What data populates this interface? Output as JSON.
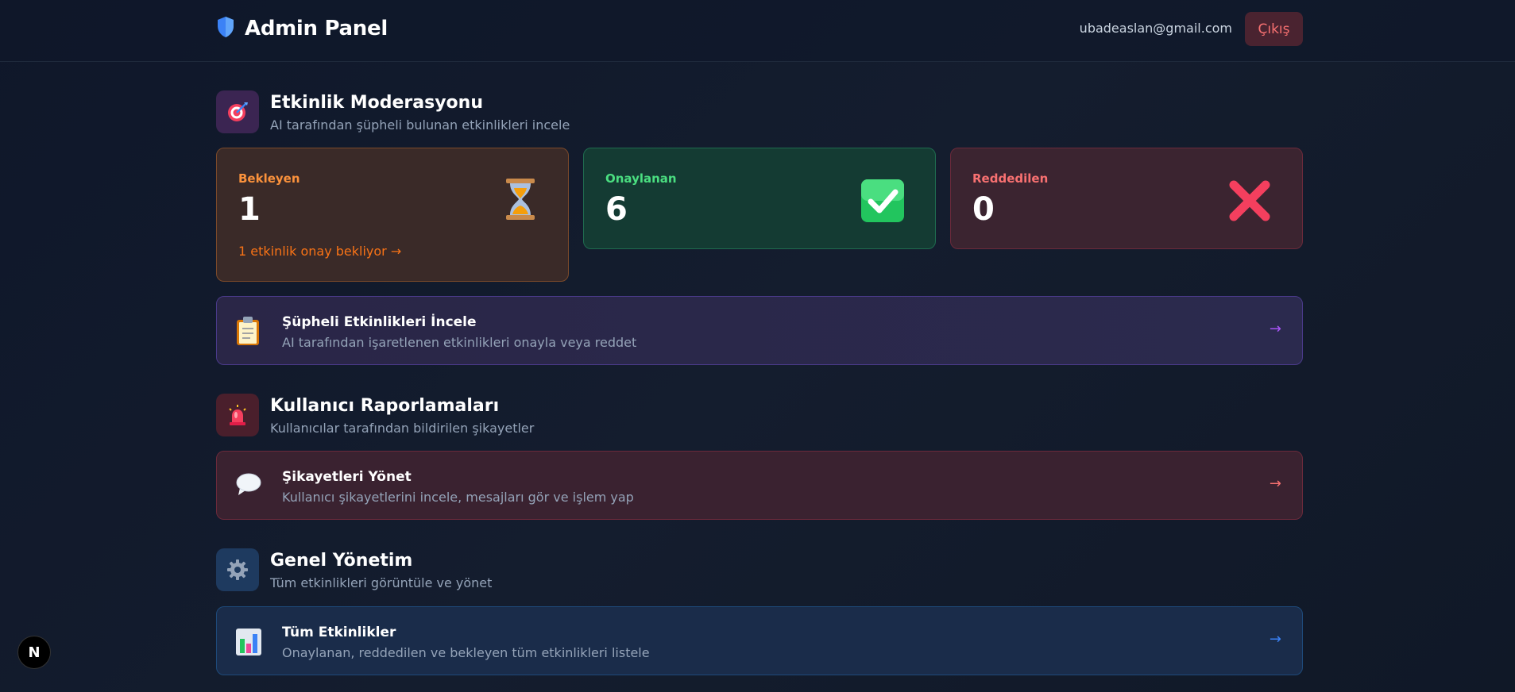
{
  "header": {
    "title": "Admin Panel",
    "email": "ubadeaslan@gmail.com",
    "logout_label": "Çıkış"
  },
  "moderation": {
    "title": "Etkinlik Moderasyonu",
    "subtitle": "AI tarafından şüpheli bulunan etkinlikleri incele",
    "icon": "dart-target-icon",
    "stats": [
      {
        "label": "Bekleyen",
        "value": "1",
        "link": "1 etkinlik onay bekliyor →",
        "icon": "hourglass-icon",
        "color": "#fb923c"
      },
      {
        "label": "Onaylanan",
        "value": "6",
        "icon": "check-mark-icon",
        "color": "#4ade80"
      },
      {
        "label": "Reddedilen",
        "value": "0",
        "icon": "cross-mark-icon",
        "color": "#f87171"
      }
    ],
    "action": {
      "title": "Şüpheli Etkinlikleri İncele",
      "subtitle": "AI tarafından işaretlenen etkinlikleri onayla veya reddet",
      "arrow": "→",
      "icon": "clipboard-icon"
    }
  },
  "reports": {
    "title": "Kullanıcı Raporlamaları",
    "subtitle": "Kullanıcılar tarafından bildirilen şikayetler",
    "icon": "siren-icon",
    "action": {
      "title": "Şikayetleri Yönet",
      "subtitle": "Kullanıcı şikayetlerini incele, mesajları gör ve işlem yap",
      "arrow": "→",
      "icon": "speech-bubble-icon"
    }
  },
  "general": {
    "title": "Genel Yönetim",
    "subtitle": "Tüm etkinlikleri görüntüle ve yönet",
    "icon": "gear-icon",
    "action": {
      "title": "Tüm Etkinlikler",
      "subtitle": "Onaylanan, reddedilen ve bekleyen tüm etkinlikleri listele",
      "arrow": "→",
      "icon": "bar-chart-icon"
    }
  },
  "dev_badge": "N"
}
